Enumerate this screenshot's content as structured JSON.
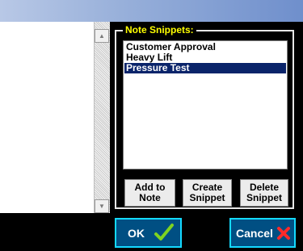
{
  "snippets": {
    "legend": "Note Snippets:",
    "items": [
      "Customer Approval",
      "Heavy Lift",
      "Pressure Test"
    ],
    "selected_item": "Pressure Test",
    "add_to_note_label": [
      "Add to",
      "Note"
    ],
    "create_snippet_label": [
      "Create",
      "Snippet"
    ],
    "delete_snippet_label": [
      "Delete",
      "Snippet"
    ]
  },
  "footer": {
    "ok_label": "OK",
    "cancel_label": "Cancel"
  },
  "colors": {
    "legend_text": "#ffff00",
    "selection_bg": "#0a246a",
    "footer_button_bg": "#004f83",
    "footer_button_border": "#14d9ff",
    "ok_check": "#7ed321",
    "cancel_x": "#ff2a2a"
  },
  "icons": {
    "ok": "check-icon",
    "cancel": "x-icon"
  }
}
